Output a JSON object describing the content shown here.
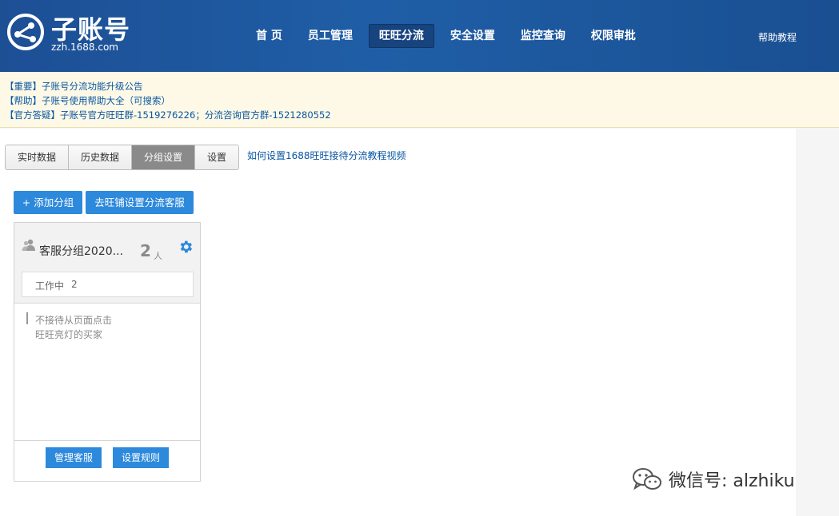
{
  "header": {
    "logo_title": "子账号",
    "logo_sub": "zzh.1688.com",
    "nav": [
      "首 页",
      "员工管理",
      "旺旺分流",
      "安全设置",
      "监控查询",
      "权限审批"
    ],
    "nav_active_index": 2,
    "help": "帮助教程"
  },
  "notice": {
    "lines": [
      {
        "tag": "【重要】",
        "text": "子账号分流功能升级公告"
      },
      {
        "tag": "【帮助】",
        "text": "子账号使用帮助大全（可搜索）"
      },
      {
        "tag": "【官方答疑】",
        "text": "子账号官方旺旺群-1519276226；分流咨询官方群-1521280552"
      }
    ]
  },
  "tabs": {
    "items": [
      "实时数据",
      "历史数据",
      "分组设置",
      "设置"
    ],
    "active_index": 2,
    "link": "如何设置1688旺旺接待分流教程视频"
  },
  "actions": {
    "add_group": "+ 添加分组",
    "go_shop": "去旺铺设置分流客服"
  },
  "group_card": {
    "name": "客服分组2020...",
    "count": "2",
    "unit": "人",
    "status_label": "工作中",
    "status_count": "2",
    "rule_line1": "不接待从页面点击",
    "rule_line2": "旺旺亮灯的买家",
    "btn_manage": "管理客服",
    "btn_rule": "设置规则"
  },
  "watermark": {
    "text": "微信号: alzhiku",
    "icon": "wechat-icon"
  },
  "colors": {
    "header_bg": "#1d4f95",
    "accent_blue": "#2d89dc",
    "link_blue": "#0a56a3",
    "notice_bg": "#fdf9e6"
  }
}
